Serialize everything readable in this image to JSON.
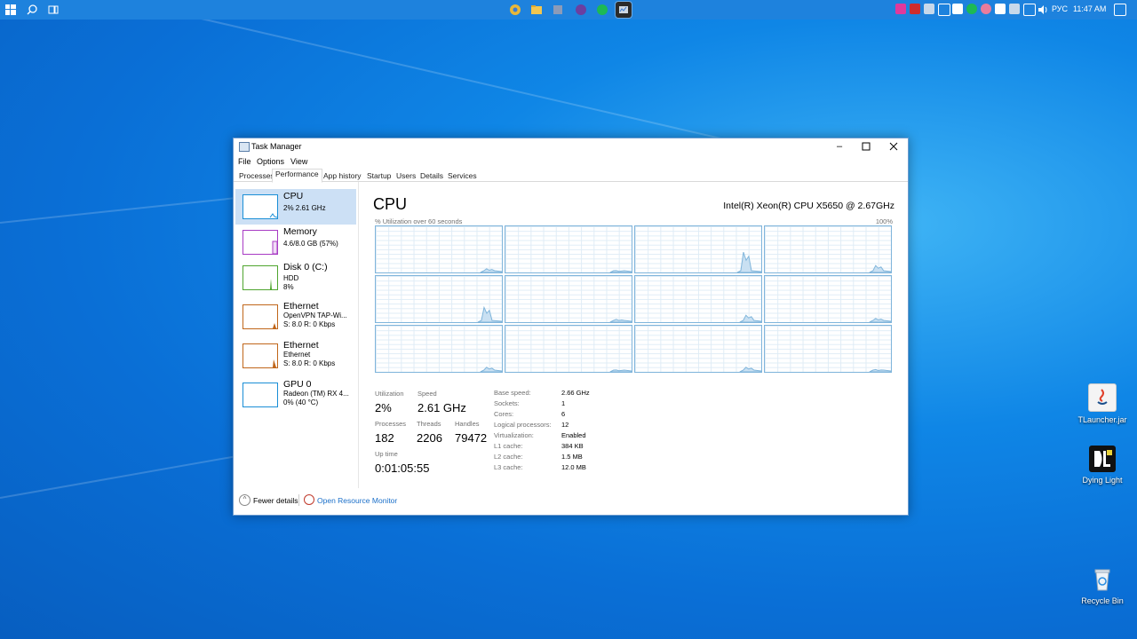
{
  "taskbar": {
    "left_icons": [
      "windows-start-icon",
      "search-icon",
      "task-view-icon"
    ],
    "apps": [
      {
        "name": "chrome-icon",
        "color": "#e8b83a"
      },
      {
        "name": "file-explorer-icon",
        "color": "#f3c64f"
      },
      {
        "name": "app-icon",
        "color": "#8c9bb8"
      },
      {
        "name": "vpn-icon",
        "color": "#6b3fa0"
      },
      {
        "name": "spotify-icon",
        "color": "#1db954"
      },
      {
        "name": "task-manager-icon",
        "color": "#cfd8e3"
      }
    ],
    "tray": {
      "language": "РУС",
      "time": "11:47 AM"
    }
  },
  "desktop": {
    "icons": [
      {
        "label": "TLauncher.jar"
      },
      {
        "label": "Dying Light"
      },
      {
        "label": "Recycle Bin"
      }
    ]
  },
  "window": {
    "title": "Task Manager",
    "menu": [
      "File",
      "Options",
      "View"
    ],
    "tabs": [
      "Processes",
      "Performance",
      "App history",
      "Startup",
      "Users",
      "Details",
      "Services"
    ],
    "active_tab": "Performance"
  },
  "sidebar": {
    "items": [
      {
        "name": "CPU",
        "sub1": "2% 2.61 GHz",
        "sub2": "",
        "color": "#1a8ed6"
      },
      {
        "name": "Memory",
        "sub1": "4.6/8.0 GB (57%)",
        "sub2": "",
        "color": "#a83bc4"
      },
      {
        "name": "Disk 0 (C:)",
        "sub1": "HDD",
        "sub2": "8%",
        "color": "#4fa52f"
      },
      {
        "name": "Ethernet",
        "sub1": "OpenVPN TAP-Wi...",
        "sub2": "S: 8.0 R: 0 Kbps",
        "color": "#c0661a"
      },
      {
        "name": "Ethernet",
        "sub1": "Ethernet",
        "sub2": "S: 8.0 R: 0 Kbps",
        "color": "#c0661a"
      },
      {
        "name": "GPU 0",
        "sub1": "Radeon (TM) RX 4...",
        "sub2": "0% (40 °C)",
        "color": "#1a8ed6"
      }
    ]
  },
  "main": {
    "title": "CPU",
    "cpu_model": "Intel(R) Xeon(R) CPU X5650 @ 2.67GHz",
    "util_label": "% Utilization over 60 seconds",
    "util_max": "100%",
    "graph_color": "#80b5db",
    "graph_fill": "#c9e0f2",
    "graph_peaks": [
      {
        "pos": 0.9,
        "h": 0.08
      },
      {
        "pos": 0.9,
        "h": 0.04
      },
      {
        "pos": 0.88,
        "h": 0.44
      },
      {
        "pos": 0.9,
        "h": 0.15
      },
      {
        "pos": 0.88,
        "h": 0.32
      },
      {
        "pos": 0.9,
        "h": 0.06
      },
      {
        "pos": 0.9,
        "h": 0.15
      },
      {
        "pos": 0.9,
        "h": 0.08
      },
      {
        "pos": 0.9,
        "h": 0.1
      },
      {
        "pos": 0.9,
        "h": 0.04
      },
      {
        "pos": 0.9,
        "h": 0.1
      },
      {
        "pos": 0.9,
        "h": 0.05
      }
    ],
    "stats": {
      "utilization_label": "Utilization",
      "utilization": "2%",
      "speed_label": "Speed",
      "speed": "2.61 GHz",
      "processes_label": "Processes",
      "processes": "182",
      "threads_label": "Threads",
      "threads": "2206",
      "handles_label": "Handles",
      "handles": "79472",
      "uptime_label": "Up time",
      "uptime": "0:01:05:55"
    },
    "specs": [
      {
        "label": "Base speed:",
        "value": "2.66 GHz"
      },
      {
        "label": "Sockets:",
        "value": "1"
      },
      {
        "label": "Cores:",
        "value": "6"
      },
      {
        "label": "Logical processors:",
        "value": "12"
      },
      {
        "label": "Virtualization:",
        "value": "Enabled"
      },
      {
        "label": "L1 cache:",
        "value": "384 KB"
      },
      {
        "label": "L2 cache:",
        "value": "1.5 MB"
      },
      {
        "label": "L3 cache:",
        "value": "12.0 MB"
      }
    ]
  },
  "footer": {
    "fewer_details": "Fewer details",
    "open_resource_monitor": "Open Resource Monitor"
  }
}
